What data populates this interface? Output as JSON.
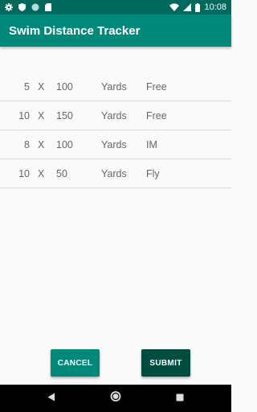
{
  "status_bar": {
    "time": "10:08",
    "icons": [
      "gear-icon",
      "shield-icon",
      "circle-icon",
      "sd-card-icon",
      "wifi-icon",
      "signal-icon",
      "battery-icon"
    ]
  },
  "app_bar": {
    "title": "Swim Distance Tracker"
  },
  "sets": [
    {
      "reps": "5",
      "x": "X",
      "distance": "100",
      "unit": "Yards",
      "stroke": "Free"
    },
    {
      "reps": "10",
      "x": "X",
      "distance": "150",
      "unit": "Yards",
      "stroke": "Free"
    },
    {
      "reps": "8",
      "x": "X",
      "distance": "100",
      "unit": "Yards",
      "stroke": "IM"
    },
    {
      "reps": "10",
      "x": "X",
      "distance": "50",
      "unit": "Yards",
      "stroke": "Fly"
    }
  ],
  "buttons": {
    "cancel_label": "CANCEL",
    "submit_label": "SUBMIT"
  },
  "colors": {
    "status_bar": "#00695c",
    "primary": "#00897b",
    "submit": "#004d40",
    "background": "#fafafa"
  },
  "nav_bar": {
    "icons": [
      "back-icon",
      "home-icon",
      "recents-icon"
    ]
  }
}
